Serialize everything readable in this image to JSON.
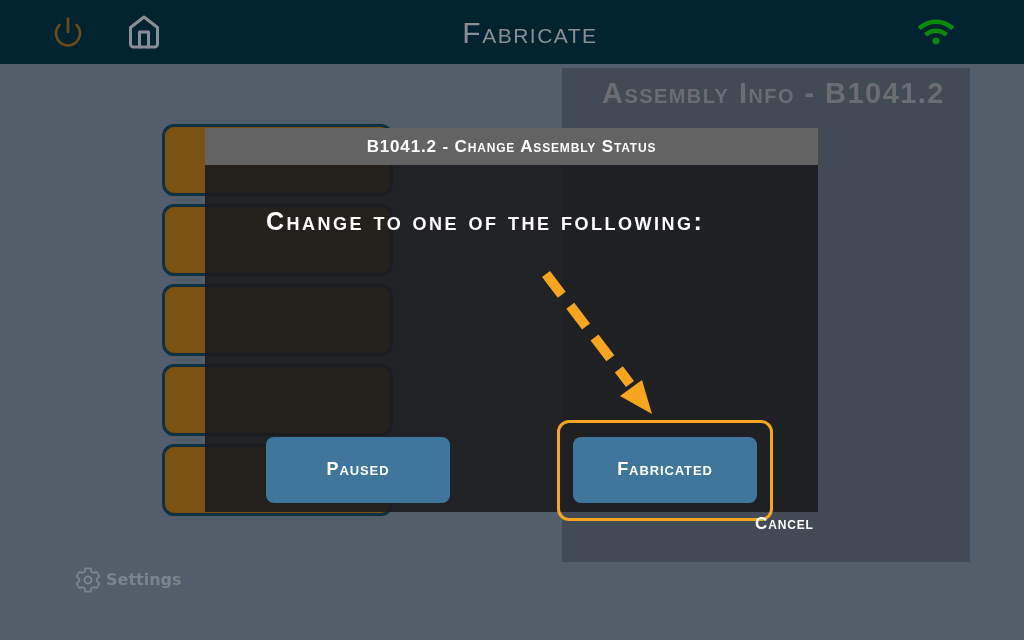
{
  "header": {
    "title": "Fabricate"
  },
  "sidebar": {
    "items": [
      {
        "kind": "menu-button"
      },
      {
        "kind": "menu-button"
      },
      {
        "kind": "menu-button"
      },
      {
        "kind": "menu-button"
      },
      {
        "kind": "menu-button"
      }
    ]
  },
  "settings": {
    "label": "Settings"
  },
  "assembly_info": {
    "title": "Assembly Info - B1041.2"
  },
  "dialog": {
    "title": "B1041.2 - Change Assembly Status",
    "prompt": "Change to one of the following:",
    "options": [
      {
        "label": "Paused",
        "highlighted": false
      },
      {
        "label": "Fabricated",
        "highlighted": true
      }
    ],
    "cancel": "Cancel"
  }
}
